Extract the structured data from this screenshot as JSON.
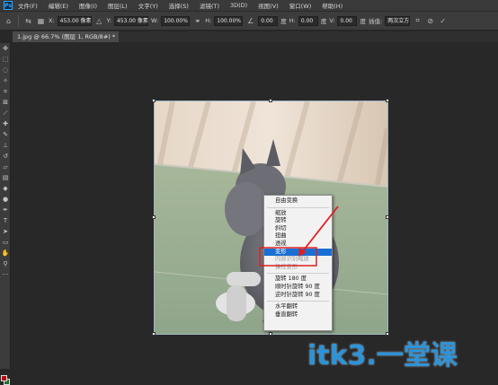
{
  "menubar": {
    "logo": "Ps",
    "items": [
      "文件(F)",
      "编辑(E)",
      "图像(I)",
      "图层(L)",
      "文字(Y)",
      "选择(S)",
      "滤镜(T)",
      "3D(D)",
      "视图(V)",
      "窗口(W)",
      "帮助(H)"
    ]
  },
  "options_bar": {
    "x_label": "X:",
    "x_value": "453.00 像素",
    "y_label": "Y:",
    "y_value": "453.00 像素",
    "w_label": "W:",
    "w_value": "100.00%",
    "h_label": "H:",
    "h_value": "100.00%",
    "angle_value": "0.00",
    "angle_unit": "度",
    "hskew_label": "H:",
    "hskew_value": "0.00",
    "hskew_unit": "度",
    "vskew_label": "V:",
    "vskew_value": "0.00",
    "vskew_unit": "度",
    "interp_label": "插值:",
    "interp_value": "两次立方"
  },
  "document_tab": {
    "title": "1.jpg @ 66.7% (图层 1, RGB/8#) *"
  },
  "context_menu": {
    "items": [
      {
        "label": "自由变换",
        "state": "normal"
      },
      {
        "sep": true
      },
      {
        "label": "缩放",
        "state": "normal"
      },
      {
        "label": "旋转",
        "state": "normal"
      },
      {
        "label": "斜切",
        "state": "normal"
      },
      {
        "label": "扭曲",
        "state": "normal"
      },
      {
        "label": "透视",
        "state": "normal"
      },
      {
        "label": "变形",
        "state": "selected"
      },
      {
        "label": "内容识别缩放",
        "state": "disabled"
      },
      {
        "label": "操控变形",
        "state": "disabled"
      },
      {
        "sep": true
      },
      {
        "label": "旋转 180 度",
        "state": "normal"
      },
      {
        "label": "顺时针旋转 90 度",
        "state": "normal"
      },
      {
        "label": "逆时针旋转 90 度",
        "state": "normal"
      },
      {
        "sep": true
      },
      {
        "label": "水平翻转",
        "state": "normal"
      },
      {
        "label": "垂直翻转",
        "state": "normal"
      }
    ]
  },
  "watermark": {
    "text": "itk3.一堂课"
  },
  "colors": {
    "selected_bg": "#1a6fd3",
    "annotation_red": "#e02020",
    "foreground": "#b20f0f",
    "background": "#1c6e2c"
  }
}
